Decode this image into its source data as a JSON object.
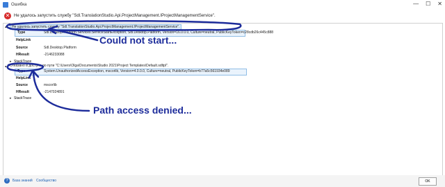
{
  "window": {
    "title": "Ошибка",
    "controls": [
      "—",
      "☐",
      "✕"
    ]
  },
  "header": {
    "message": "Не удалось запустить службу \"Sdl.TranslationStudio.Api.ProjectManagement.IProjectManagementService\"."
  },
  "exceptions": [
    {
      "heading": "Не удалось запустить службу \"Sdl.TranslationStudio.Api.ProjectManagement.IProjectManagementService\".",
      "properties": [
        {
          "key": "Type",
          "value": "Sdl.Desktop.Platform.Services.ServiceStartException, Sdl.Desktop.Platform, Version=16.0.0.0, Culture=neutral, PublicKeyToken=c28cdb26c445c888"
        },
        {
          "key": "HelpLink",
          "value": ""
        },
        {
          "key": "Source",
          "value": "Sdl.Desktop.Platform"
        },
        {
          "key": "HResult",
          "value": "-2146233088"
        }
      ],
      "stacktrace_label": "StackTrace"
    },
    {
      "heading": "Отказано в доступе по пути \"C:\\Users\\Olga\\Documents\\Studio 2021\\Project Templates\\Default.sdltpl\".",
      "properties": [
        {
          "key": "Type",
          "value": "System.UnauthorizedAccessException, mscorlib, Version=4.0.0.0, Culture=neutral, PublicKeyToken=b77a5c561934e089"
        },
        {
          "key": "HelpLink",
          "value": ""
        },
        {
          "key": "Source",
          "value": "mscorlib"
        },
        {
          "key": "HResult",
          "value": "-2147024891"
        }
      ],
      "stacktrace_label": "StackTrace"
    }
  ],
  "annotations": {
    "first": "Could not start...",
    "second": "Path access denied..."
  },
  "footer": {
    "kb_link": "База знаний",
    "community_link": "Сообщество",
    "ok_label": "OK"
  },
  "colors": {
    "annotation": "#1d2c9b",
    "error": "#d72b2b",
    "selection": "#dbeaf7"
  }
}
